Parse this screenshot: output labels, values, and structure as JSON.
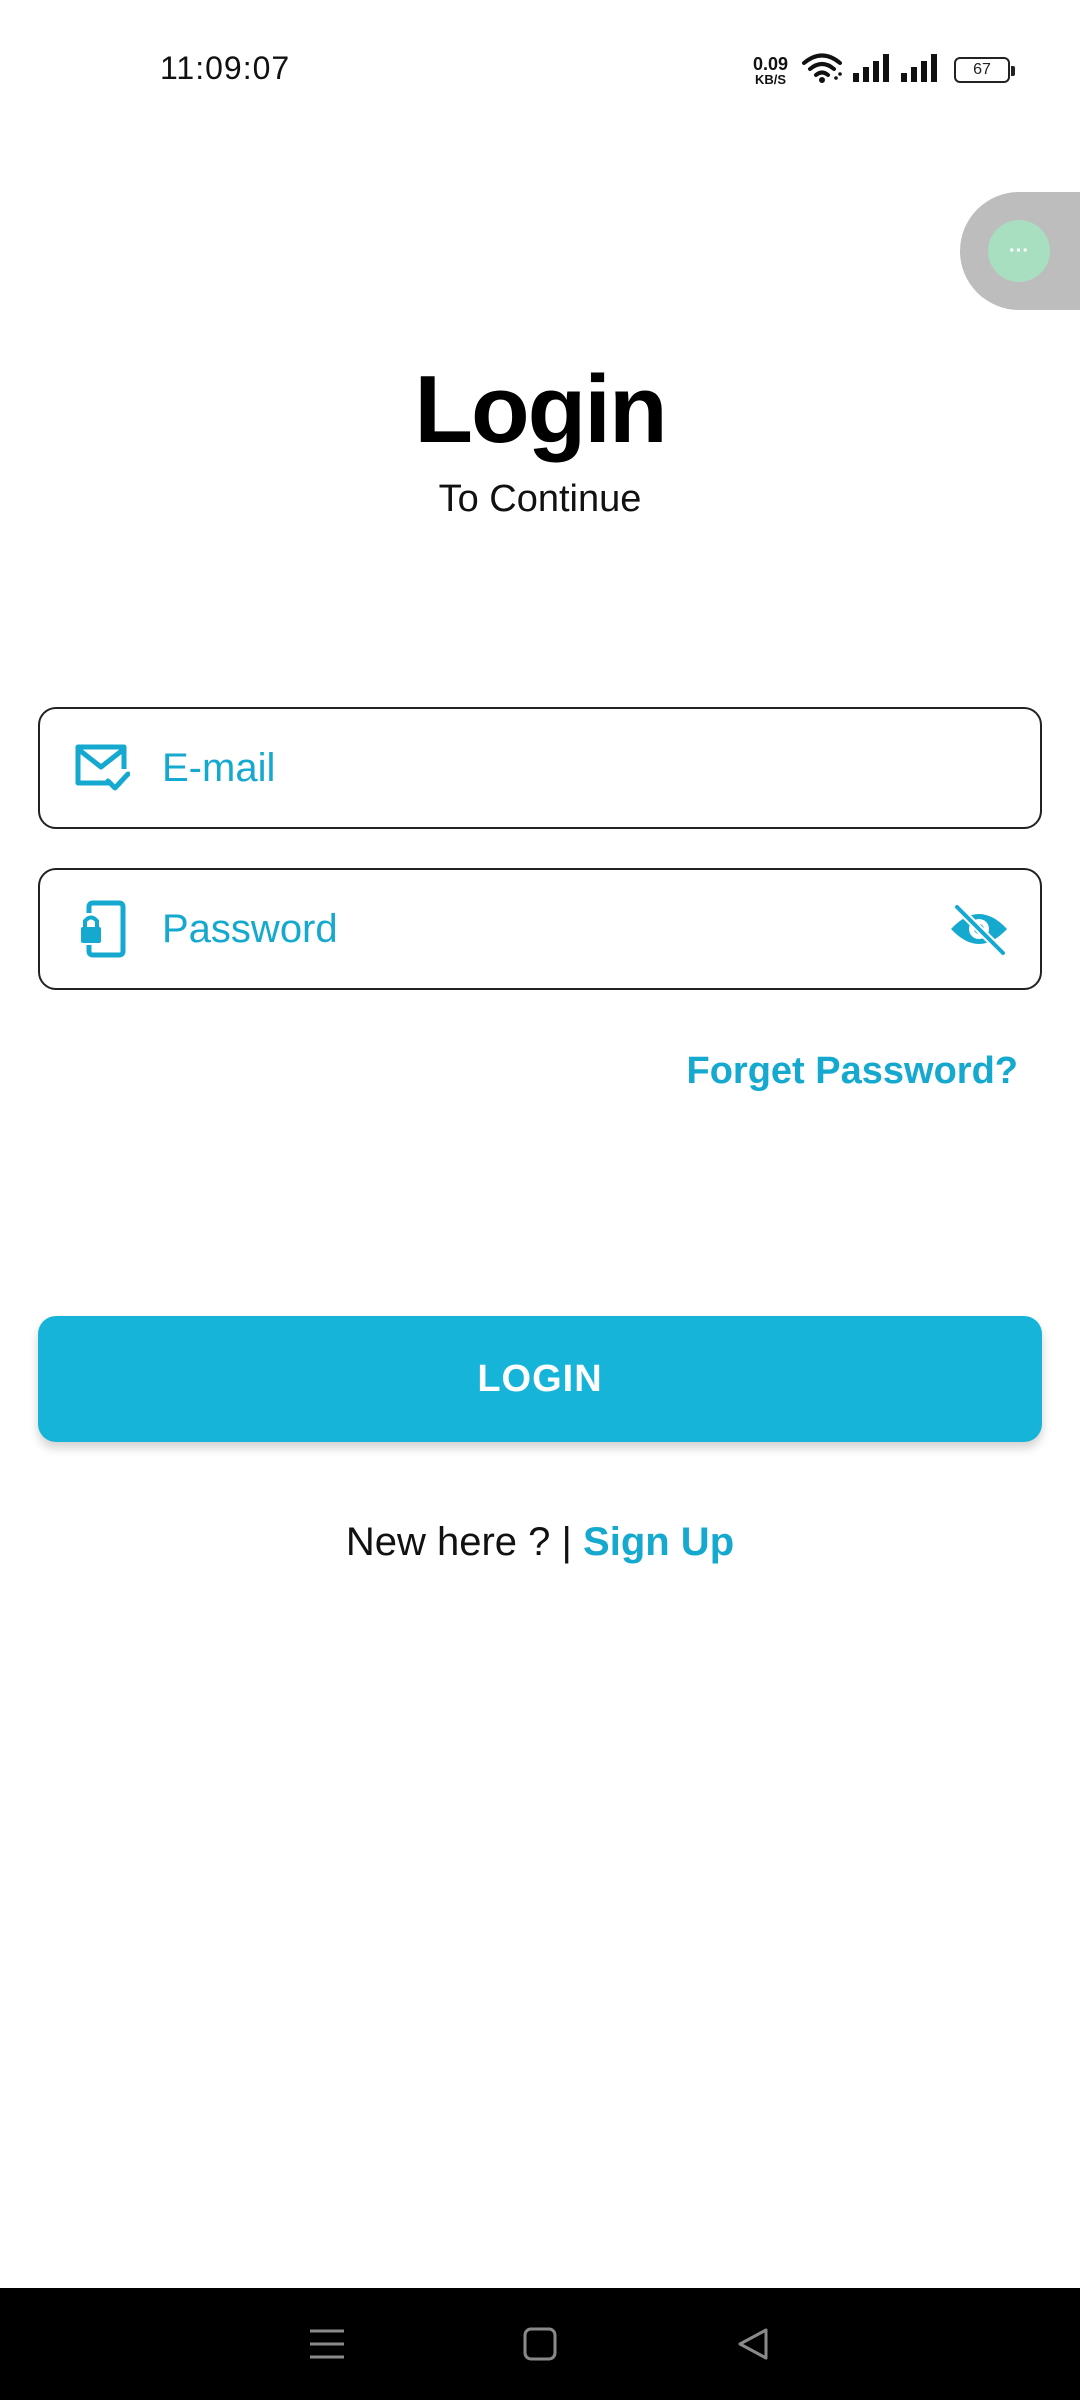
{
  "status_bar": {
    "time": "11:09:07",
    "net_speed_value": "0.09",
    "net_speed_unit": "KB/S",
    "battery": "67"
  },
  "floating_bubble": {
    "label": "···"
  },
  "header": {
    "title": "Login",
    "subtitle": "To Continue"
  },
  "form": {
    "email_placeholder": "E-mail",
    "email_value": "",
    "password_placeholder": "Password",
    "password_value": "",
    "forgot_label": "Forget Password?",
    "login_label": "LOGIN"
  },
  "signup": {
    "prompt": "New here ? | ",
    "link": "Sign Up"
  },
  "colors": {
    "accent": "#16b4d8",
    "accent_text": "#16a9cf",
    "bubble": "#bdbdbd",
    "bubble_dot": "#a8dfc0",
    "nav_bar": "#000000"
  },
  "icons": {
    "email": "mail-check-icon",
    "password": "phone-lock-icon",
    "visibility": "eye-off-icon",
    "wifi": "wifi-icon",
    "signal": "signal-icon",
    "nav_menu": "menu-icon",
    "nav_home": "home-square-icon",
    "nav_back": "back-triangle-icon"
  }
}
